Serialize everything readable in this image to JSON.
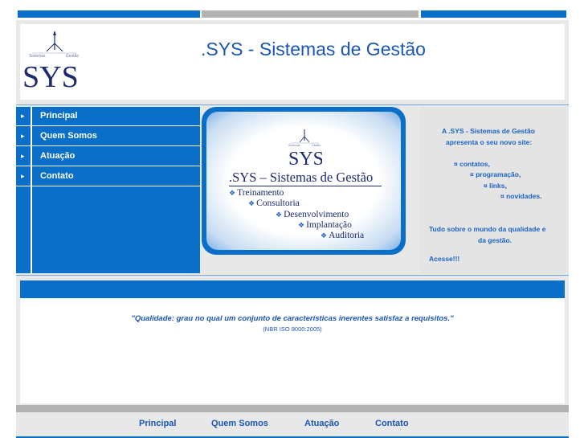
{
  "header": {
    "logo_text": "SYS",
    "logo_small_left": "Sistemas",
    "logo_small_right": "Gestão",
    "title": ".SYS - Sistemas de Gestão"
  },
  "nav": {
    "items": [
      {
        "label": "Principal"
      },
      {
        "label": "Quem Somos"
      },
      {
        "label": "Atuação"
      },
      {
        "label": "Contato"
      }
    ]
  },
  "banner": {
    "logo_text": "SYS",
    "logo_small_left": "Sistemas",
    "logo_small_right": "Gestão",
    "title": ".SYS – Sistemas de Gestão",
    "services": [
      "Treinamento",
      "Consultoria",
      "Desenvolvimento",
      "Implantação",
      "Auditoria"
    ]
  },
  "info": {
    "line1": "A .SYS - Sistemas de Gestão",
    "line2": "apresenta o seu novo site:",
    "items": [
      "¤ contatos,",
      "¤ programação,",
      "¤ links,",
      "¤ novidades."
    ],
    "line3": "Tudo sobre o mundo da qualidade e",
    "line4": "da gestão.",
    "line5": "Acesse!!!"
  },
  "content": {
    "quote": "\"Qualidade: grau no qual um conjunto de características inerentes satisfaz a requisitos.\"",
    "quote_source": "(NBR ISO 9000:2005)"
  },
  "footer": {
    "links": [
      "Principal",
      "Quem Somos",
      "Atuação",
      "Contato"
    ]
  },
  "colors": {
    "primary_blue": "#0a6fc9",
    "text_blue": "#1a56b8",
    "grey": "#b3b3b3",
    "panel_grey": "#e4e4e4"
  }
}
